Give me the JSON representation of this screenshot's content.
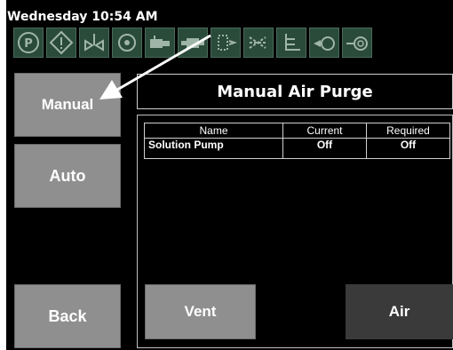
{
  "status": {
    "clock": "Wednesday 10:54 AM"
  },
  "toolbar": {
    "icons": [
      "p-icon",
      "warning-icon",
      "valve-icon",
      "engine-icon",
      "pump-icon",
      "motor-icon",
      "injector-icon",
      "spray-icon",
      "heater-icon",
      "tank-icon",
      "tank-2-icon"
    ]
  },
  "nav": {
    "manual_label": "Manual",
    "auto_label": "Auto",
    "back_label": "Back"
  },
  "main": {
    "title": "Manual Air Purge"
  },
  "table": {
    "headers": [
      "Name",
      "Current",
      "Required"
    ],
    "rows": [
      {
        "name": "Solution Pump",
        "current": "Off",
        "required": "Off"
      }
    ]
  },
  "actions": {
    "vent_label": "Vent",
    "air_label": "Air"
  },
  "colors": {
    "button_gray": "#8f8f8f",
    "icon_green": "#2a4a3a",
    "air_dark": "#3a3a3a"
  }
}
